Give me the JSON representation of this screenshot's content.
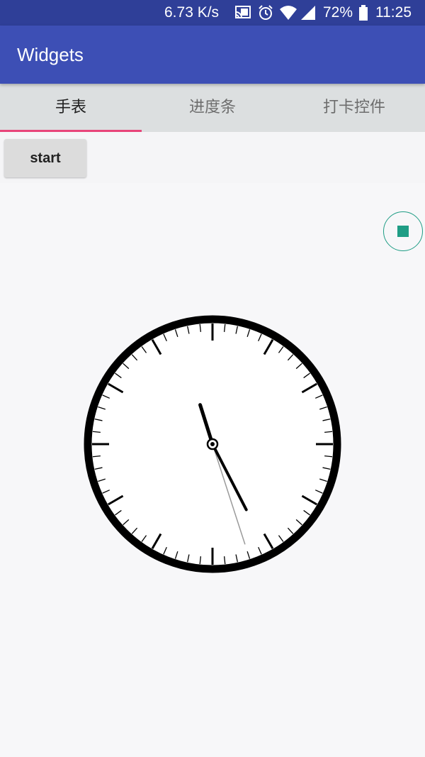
{
  "status_bar": {
    "speed": "6.73 K/s",
    "battery": "72%",
    "time": "11:25",
    "icons": [
      "cast-icon",
      "alarm-icon",
      "wifi-icon",
      "signal-icon",
      "battery-icon"
    ]
  },
  "app_bar": {
    "title": "Widgets"
  },
  "tabs": [
    {
      "label": "手表",
      "active": true
    },
    {
      "label": "进度条",
      "active": false
    },
    {
      "label": "打卡控件",
      "active": false
    }
  ],
  "controls": {
    "start_label": "start",
    "stop_icon": "stop-icon"
  },
  "clock": {
    "hour": 11,
    "minute": 25,
    "second": 27
  },
  "colors": {
    "status_bar": "#2f3f98",
    "app_bar": "#3d4fb5",
    "tab_bar": "#dcdfe0",
    "tab_indicator": "#e8457a",
    "accent_teal": "#1f9d85",
    "background": "#f7f7f9"
  }
}
